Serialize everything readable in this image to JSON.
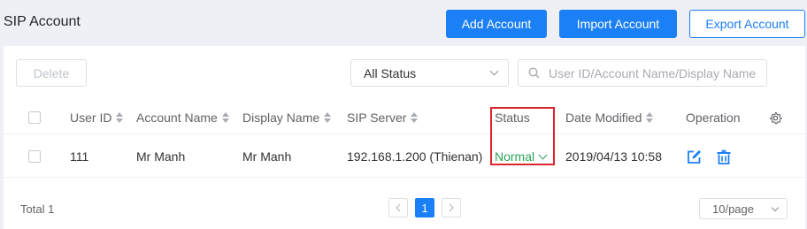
{
  "header": {
    "title": "SIP Account",
    "add_label": "Add Account",
    "import_label": "Import Account",
    "export_label": "Export Account"
  },
  "toolbar": {
    "delete_label": "Delete",
    "status_filter": "All Status",
    "search_placeholder": "User ID/Account Name/Display Name"
  },
  "table": {
    "columns": {
      "user_id": "User ID",
      "account_name": "Account Name",
      "display_name": "Display Name",
      "sip_server": "SIP Server",
      "status": "Status",
      "date_modified": "Date Modified",
      "operation": "Operation"
    },
    "rows": [
      {
        "user_id": "111",
        "account_name": "Mr Manh",
        "display_name": "Mr Manh",
        "sip_server": "192.168.1.200 (Thienan)",
        "status": "Normal",
        "date_modified": "2019/04/13 10:58"
      }
    ]
  },
  "pagination": {
    "total": "Total 1",
    "current_page": "1",
    "page_size": "10/page"
  },
  "colors": {
    "primary": "#1b7ff6",
    "status_normal": "#29a35a",
    "highlight": "#d9262c"
  }
}
